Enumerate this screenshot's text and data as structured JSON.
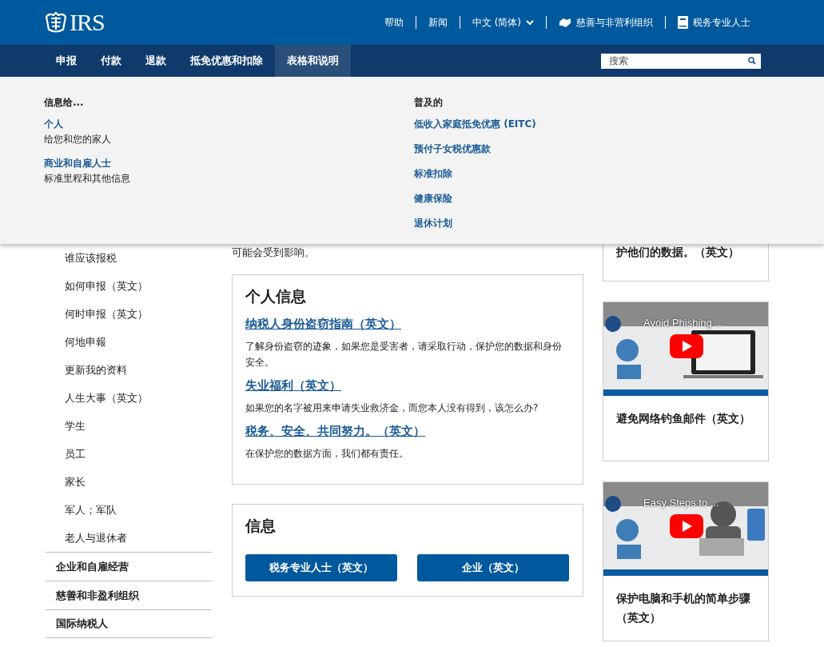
{
  "header": {
    "logo_text": "IRS",
    "top_links": [
      {
        "label": "帮助",
        "kind": "plain"
      },
      {
        "label": "新闻",
        "kind": "plain"
      },
      {
        "label": "中文 (简体)",
        "kind": "dropdown"
      },
      {
        "label": "慈善与非营利组织",
        "kind": "icon"
      },
      {
        "label": "税务专业人士",
        "kind": "icon"
      }
    ]
  },
  "nav": {
    "items": [
      {
        "label": "申报",
        "selected": false
      },
      {
        "label": "付款",
        "selected": false
      },
      {
        "label": "退款",
        "selected": false
      },
      {
        "label": "抵免优惠和扣除",
        "selected": false
      },
      {
        "label": "表格和说明",
        "selected": true
      }
    ],
    "search": {
      "placeholder": "搜索"
    }
  },
  "mega_menu": {
    "left": {
      "heading": "信息给...",
      "items": [
        {
          "link": "个人",
          "description": "给您和您的家人"
        },
        {
          "link": "商业和自雇人士",
          "description": "标准里程和其他信息"
        }
      ]
    },
    "right": {
      "heading": "普及的",
      "links": [
        "低收入家庭抵免优惠 (EITC)",
        "预付子女税优惠款",
        "标准扣除",
        "健康保险",
        "退休计划"
      ]
    }
  },
  "sidebar": {
    "sub_items": [
      "谁应该报税",
      "如何申报（英文）",
      "何时申报（英文）",
      "何地申報",
      "更新我的资料",
      "人生大事（英文）",
      "学生",
      "员工",
      "家长",
      "军人；军队",
      "老人与退休者"
    ],
    "sections": [
      "企业和自雇经营",
      "慈善和非盈利组织",
      "国际纳税人"
    ]
  },
  "main": {
    "intro_tail": "可能会受到影响。",
    "personal_card": {
      "title": "个人信息",
      "entries": [
        {
          "link": "纳税人身份盗窃指南（英文）",
          "text": "了解身份盗窃的迹象，如果您是受害者，请采取行动，保护您的数据和身份安全。"
        },
        {
          "link": "失业福利（英文）",
          "text": "如果您的名字被用来申请失业救济金，而您本人没有得到，该怎么办?"
        },
        {
          "link": "税务、安全、共同努力。（英文）",
          "text": "在保护您的数据方面，我们都有责任。"
        }
      ]
    },
    "info_card": {
      "title": "信息",
      "buttons": [
        "税务专业人士（英文）",
        "企业（英文）"
      ]
    }
  },
  "aside": {
    "partial_card": {
      "title": "护他们的数据。（英文）"
    },
    "videos": [
      {
        "video_title": "Avoid Phishing ...",
        "caption": "避免网络钓鱼邮件（英文）"
      },
      {
        "video_title": "Easy Steps to ...",
        "caption": "保护电脑和手机的简单步骤（英文）"
      }
    ]
  }
}
